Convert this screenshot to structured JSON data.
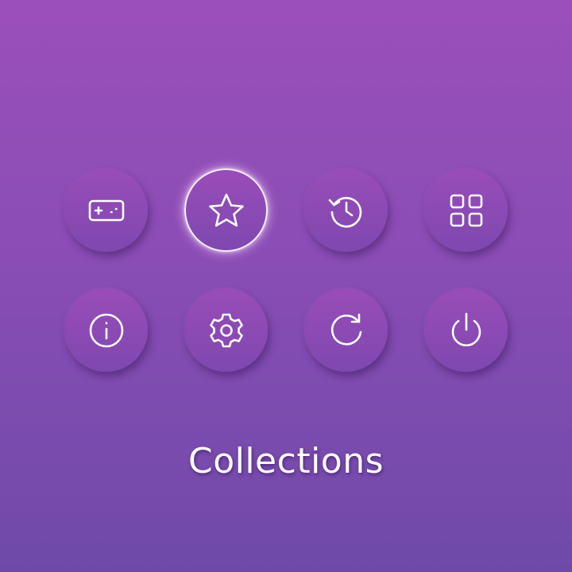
{
  "selected_item": "favorites",
  "menu": {
    "items": [
      {
        "id": "games",
        "icon": "gamepad-icon"
      },
      {
        "id": "favorites",
        "icon": "star-icon",
        "selected": true
      },
      {
        "id": "history",
        "icon": "history-icon"
      },
      {
        "id": "apps",
        "icon": "grid-icon"
      },
      {
        "id": "info",
        "icon": "info-icon"
      },
      {
        "id": "settings",
        "icon": "gear-icon"
      },
      {
        "id": "refresh",
        "icon": "refresh-icon"
      },
      {
        "id": "power",
        "icon": "power-icon"
      }
    ]
  },
  "caption": {
    "text": "Collections"
  },
  "colors": {
    "background_top": "#9b4fb9",
    "background_bottom": "#6e4aa8",
    "button": "#8a4ab4",
    "icon": "#ffffff",
    "selected_glow": "#ffdcff"
  }
}
